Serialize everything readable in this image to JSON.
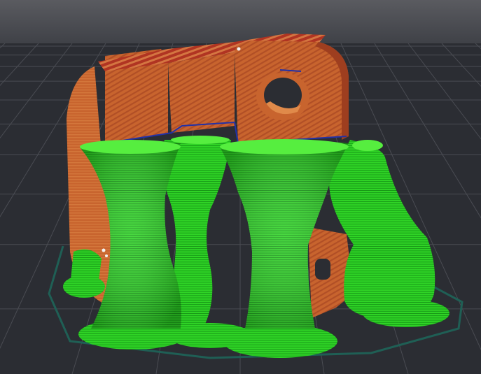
{
  "viewport": {
    "background_top": "#5a5b60",
    "background_bottom": "#2a2c31",
    "bed_color": "#2b2d33",
    "grid_color": "#4a4c53",
    "skirt_color": "#1f5f55"
  },
  "model": {
    "part_color": "#c8642e",
    "part_dark": "#9e3e1f",
    "part_stripe": "#e08a4a",
    "overhang_color": "#b03422",
    "seam_color": "#f2f2f2",
    "edge_color": "#2231a8"
  },
  "support": {
    "support_color": "#2fd326",
    "support_dark": "#118a12",
    "support_light": "#56ee3f"
  }
}
